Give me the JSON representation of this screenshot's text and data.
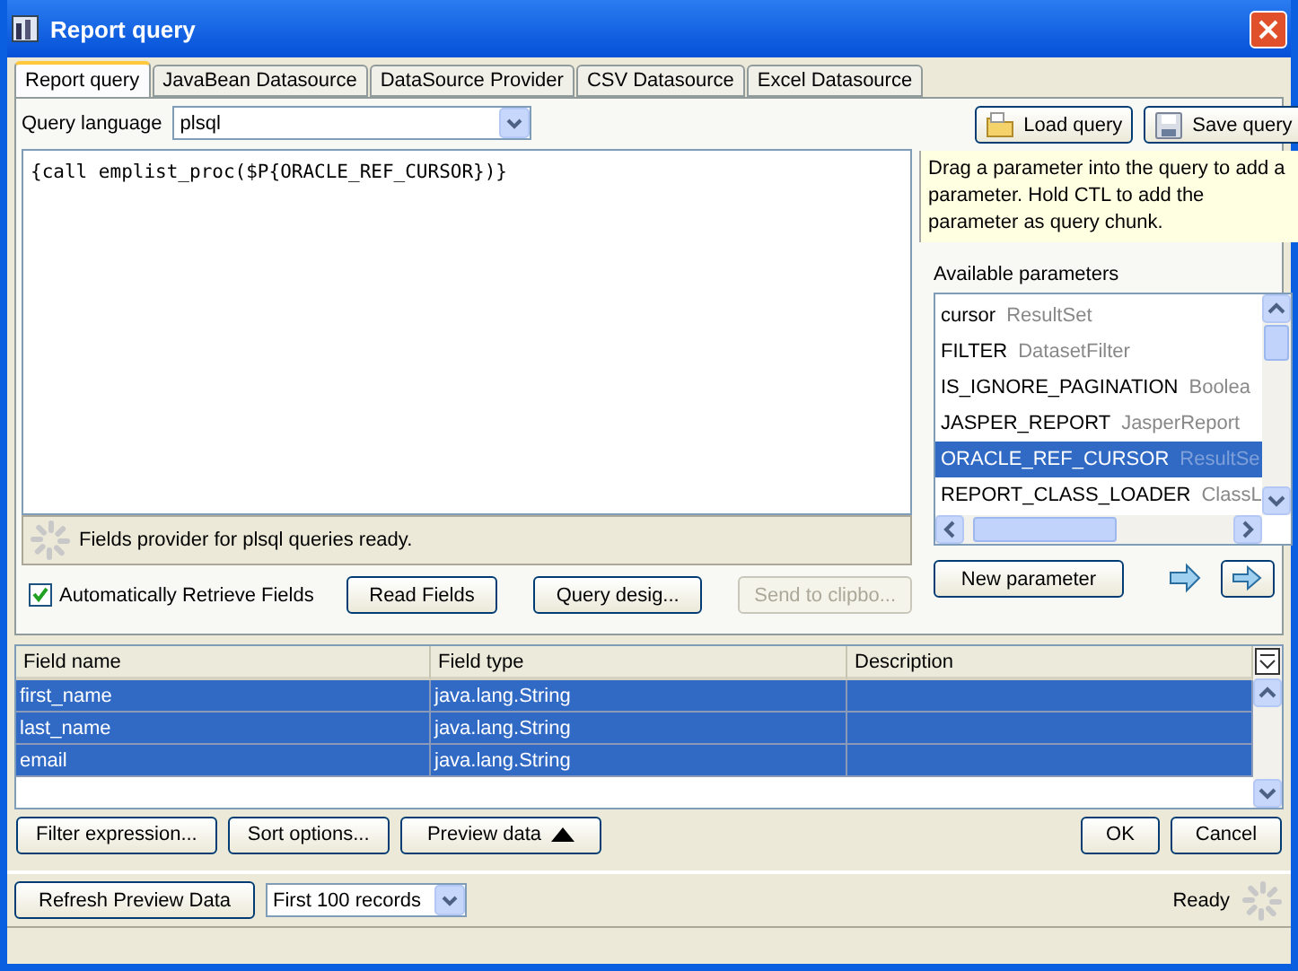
{
  "window": {
    "title": "Report query"
  },
  "tabs": [
    {
      "label": "Report query",
      "selected": true
    },
    {
      "label": "JavaBean Datasource",
      "selected": false
    },
    {
      "label": "DataSource Provider",
      "selected": false
    },
    {
      "label": "CSV Datasource",
      "selected": false
    },
    {
      "label": "Excel Datasource",
      "selected": false
    }
  ],
  "query_language": {
    "label": "Query language",
    "value": "plsql"
  },
  "query_buttons": [
    {
      "label": "Load query",
      "kind": "load"
    },
    {
      "label": "Save query",
      "kind": "save"
    }
  ],
  "query_text": "{call emplist_proc($P{ORACLE_REF_CURSOR})}",
  "hint": "Drag a parameter into the query to add a parameter. Hold CTL to add the parameter as query chunk.",
  "status_text": "Fields provider for plsql queries ready.",
  "auto_retrieve": {
    "label": "Automatically Retrieve Fields",
    "checked": true
  },
  "action_buttons": [
    {
      "label": "Read Fields",
      "disabled": false
    },
    {
      "label": "Query desig...",
      "disabled": false
    },
    {
      "label": "Send to clipbo...",
      "disabled": true
    }
  ],
  "parameters_title": "Available parameters",
  "parameters": [
    {
      "name": "cursor",
      "type": "ResultSet",
      "selected": false
    },
    {
      "name": "FILTER",
      "type": "DatasetFilter",
      "selected": false
    },
    {
      "name": "IS_IGNORE_PAGINATION",
      "type": "Boolea",
      "selected": false
    },
    {
      "name": "JASPER_REPORT",
      "type": "JasperReport",
      "selected": false
    },
    {
      "name": "ORACLE_REF_CURSOR",
      "type": "ResultSe",
      "selected": true
    },
    {
      "name": "REPORT_CLASS_LOADER",
      "type": "ClassL",
      "selected": false
    }
  ],
  "new_parameter": "New parameter",
  "fields": {
    "columns": [
      "Field name",
      "Field type",
      "Description"
    ],
    "rows": [
      {
        "name": "first_name",
        "type": "java.lang.String",
        "description": "",
        "selected": true
      },
      {
        "name": "last_name",
        "type": "java.lang.String",
        "description": "",
        "selected": true
      },
      {
        "name": "email",
        "type": "java.lang.String",
        "description": "",
        "selected": true
      }
    ]
  },
  "bottom_buttons": [
    "Filter expression...",
    "Sort options..."
  ],
  "preview_button": "Preview data",
  "dialog_buttons": [
    "OK",
    "Cancel"
  ],
  "preview": {
    "refresh": "Refresh Preview Data",
    "records": "First 100 records",
    "status": "Ready"
  }
}
